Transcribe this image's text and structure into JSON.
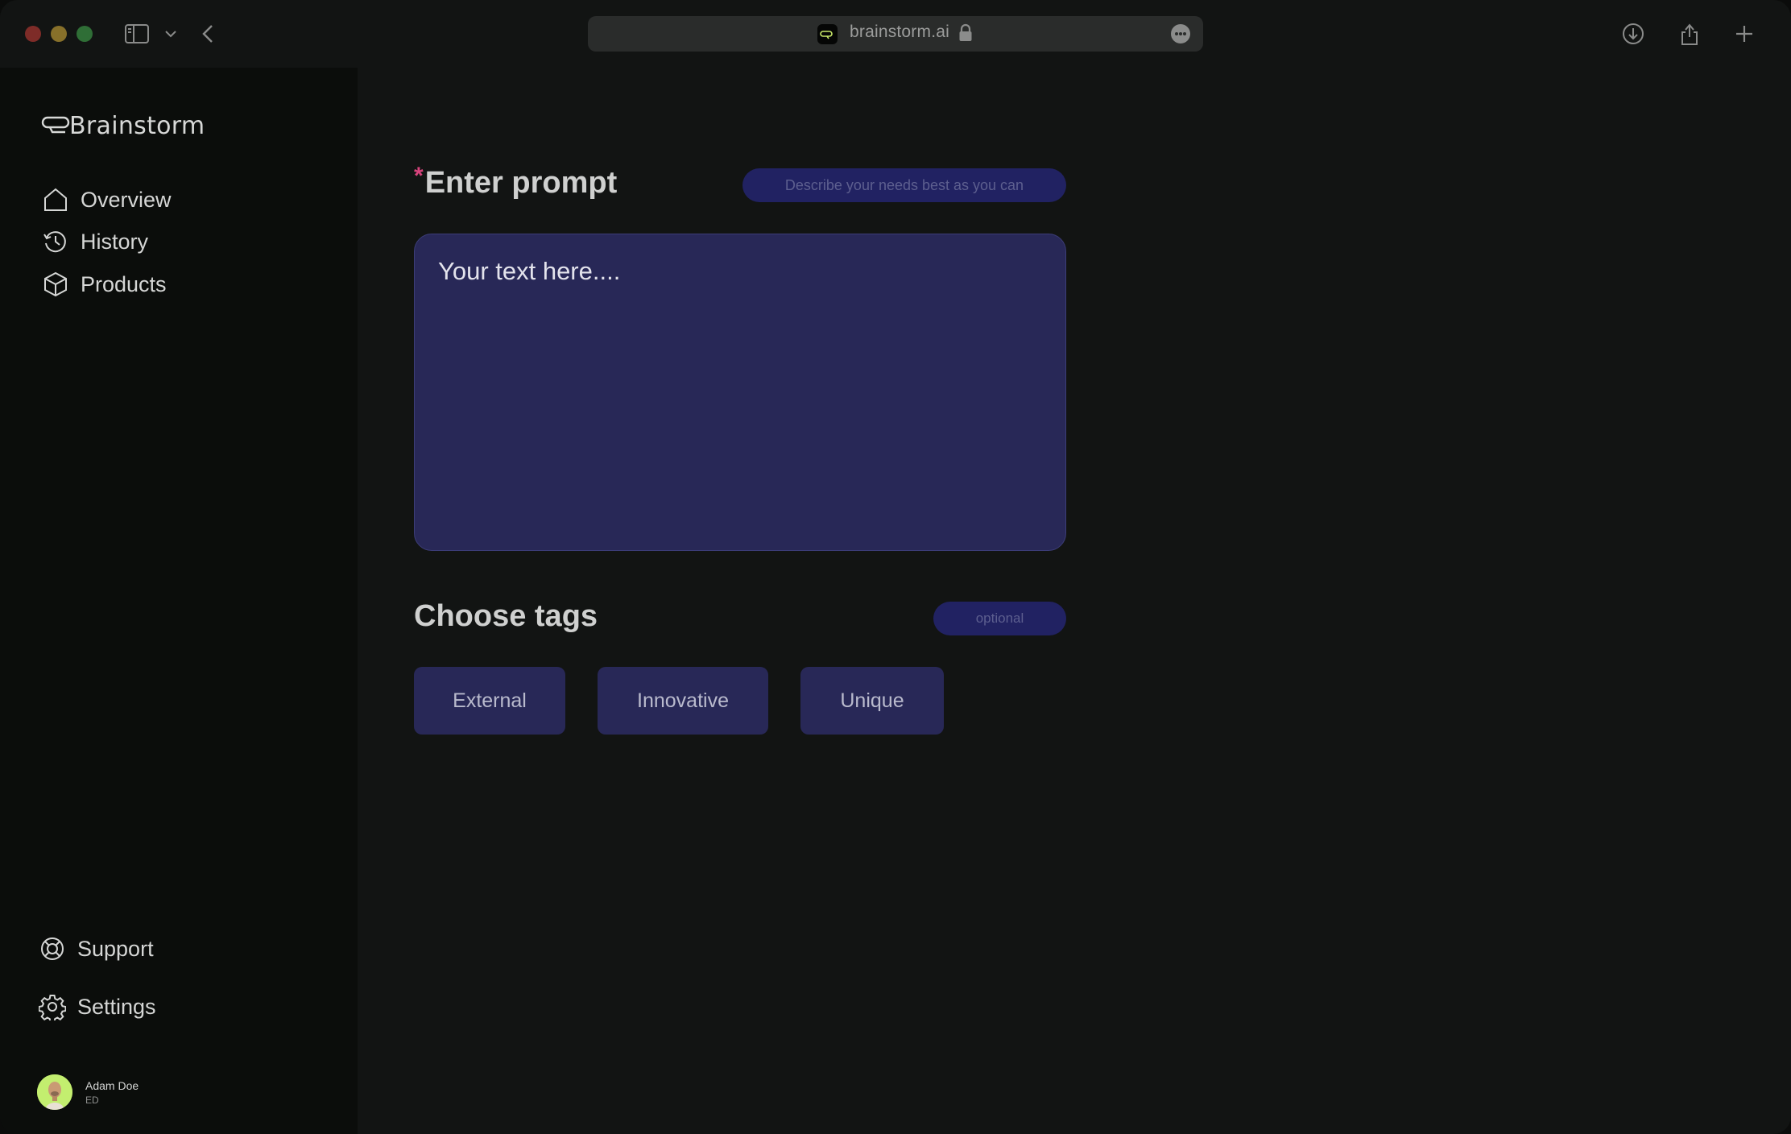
{
  "browser": {
    "url": "brainstorm.ai"
  },
  "app": {
    "brand": "Brainstorm"
  },
  "sidebar": {
    "nav": [
      {
        "label": "Overview",
        "icon": "home-icon"
      },
      {
        "label": "History",
        "icon": "history-icon"
      },
      {
        "label": "Products",
        "icon": "box-icon"
      }
    ],
    "bottom": [
      {
        "label": "Support",
        "icon": "lifebuoy-icon"
      },
      {
        "label": "Settings",
        "icon": "gear-icon"
      }
    ],
    "user": {
      "name": "Adam Doe",
      "role": "ED"
    }
  },
  "main": {
    "prompt": {
      "required_mark": "*",
      "title": "Enter prompt",
      "hint": "Describe your needs best as you can",
      "placeholder": "Your text here...."
    },
    "tags": {
      "title": "Choose tags",
      "hint": "optional",
      "items": [
        "External",
        "Innovative",
        "Unique"
      ]
    }
  },
  "colors": {
    "background": "#121413",
    "sidebar": "#0b0d0b",
    "accent_pill": "#212262",
    "input_fill": "#282857",
    "required": "#d8447d"
  }
}
